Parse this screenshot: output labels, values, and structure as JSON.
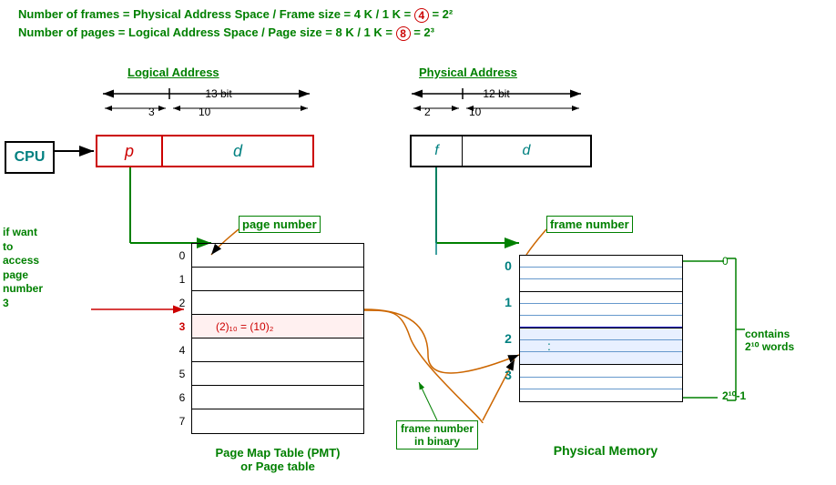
{
  "equations": {
    "eq1": "Number of frames = Physical Address Space / Frame size =  4 K / 1 K = ",
    "eq1_circled": "4",
    "eq1_rest": " = 2²",
    "eq2": "  Number of pages = Logical Address Space / Page size =  8 K / 1 K = ",
    "eq2_circled": "8",
    "eq2_rest": " = 2³"
  },
  "labels": {
    "logical_address": "Logical Address",
    "physical_address": "Physical Address",
    "bit13": "13 bit",
    "bit12": "12 bit",
    "bit3": "3",
    "bit10_logical": "10",
    "bit2": "2",
    "bit10_physical": "10",
    "cpu": "CPU",
    "p": "p",
    "d_log": "d",
    "f": "f",
    "d_phy": "d",
    "page_number": "page number",
    "frame_number": "frame number",
    "frame_binary": "frame number\nin binary",
    "if_want": "if want\nto\naccess\npage\nnumber\n3",
    "pmt_label1": "Page Map Table (PMT)",
    "pmt_label2": "or  Page table",
    "physical_mem": "Physical Memory",
    "contains": "contains\n2¹⁰ words",
    "pow10_1": "2¹⁰-1",
    "zero_right": "0"
  },
  "pmt_rows": [
    {
      "num": "0",
      "content": ""
    },
    {
      "num": "1",
      "content": ""
    },
    {
      "num": "2",
      "content": ""
    },
    {
      "num": "3",
      "content": "(2)₁₀ = (10)₂"
    },
    {
      "num": "4",
      "content": ""
    },
    {
      "num": "5",
      "content": ""
    },
    {
      "num": "6",
      "content": ""
    },
    {
      "num": "7",
      "content": ""
    }
  ],
  "phy_rows": [
    {
      "num": "0",
      "sub": 3
    },
    {
      "num": "1",
      "sub": 3
    },
    {
      "num": "2",
      "sub": 3
    },
    {
      "num": "3",
      "sub": 3
    }
  ],
  "colors": {
    "green": "#008000",
    "dark_green": "#006400",
    "red": "#cc0000",
    "teal": "#008080",
    "blue": "#0000cc",
    "orange": "#cc6600",
    "black": "#000000"
  }
}
